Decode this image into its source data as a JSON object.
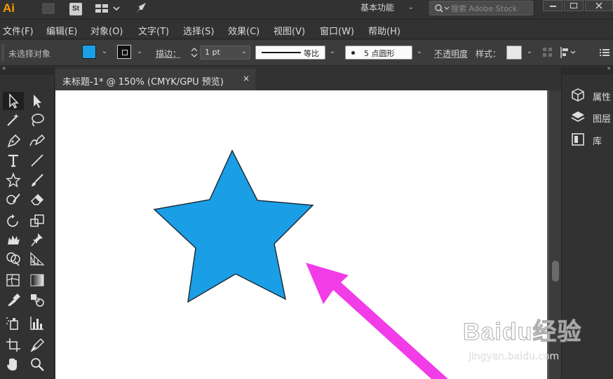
{
  "app": {
    "logo_text": "Ai",
    "stock_badge": "St",
    "workspace_label": "基本功能",
    "search_placeholder": "搜索 Adobe Stock"
  },
  "menu": {
    "items": [
      "文件(F)",
      "编辑(E)",
      "对象(O)",
      "文字(T)",
      "选择(S)",
      "效果(C)",
      "视图(V)",
      "窗口(W)",
      "帮助(H)"
    ]
  },
  "control_bar": {
    "selection_status": "未选择对象",
    "fill_color": "#1a9fe6",
    "stroke_color": "#111111",
    "stroke_label": "描边：",
    "stroke_weight": "1 pt",
    "stroke_profile": "等比",
    "brush_label": "5 点圆形",
    "opacity_label": "不透明度",
    "style_label": "样式："
  },
  "document": {
    "tab_title": "未标题-1* @ 150% (CMYK/GPU 预览)",
    "close_glyph": "×"
  },
  "canvas": {
    "star_fill": "#1a9fe6",
    "star_stroke": "#1f2d3a",
    "arrow_color": "#f23ce8"
  },
  "right_panel": {
    "items": [
      {
        "label": "属性",
        "icon": "properties-icon"
      },
      {
        "label": "图层",
        "icon": "layers-icon"
      },
      {
        "label": "库",
        "icon": "libraries-icon"
      }
    ]
  },
  "watermark": {
    "logo": "Baidu经验",
    "url": "jingyan.baidu.com"
  }
}
